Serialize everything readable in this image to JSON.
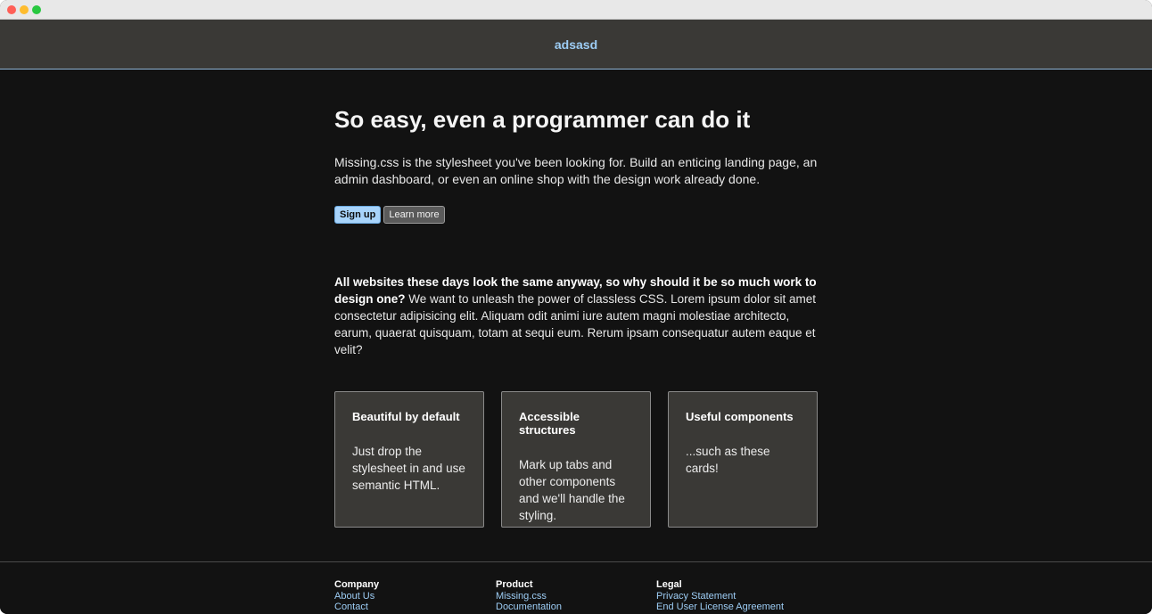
{
  "header": {
    "brand": "adsasd"
  },
  "hero": {
    "title": "So easy, even a programmer can do it",
    "lead": "Missing.css is the stylesheet you've been looking for. Build an enticing landing page, an admin dashboard, or even an online shop with the design work already done.",
    "primary_button": "Sign up",
    "secondary_button": "Learn more"
  },
  "intro": {
    "bold": "All websites these days look the same anyway, so why should it be so much work to design one?",
    "text": " We want to unleash the power of classless CSS. Lorem ipsum dolor sit amet consectetur adipisicing elit. Aliquam odit animi iure autem magni molestiae architecto, earum, quaerat quisquam, totam at sequi eum. Rerum ipsam consequatur autem eaque et velit?"
  },
  "cards": [
    {
      "title": "Beautiful by default",
      "body": "Just drop the stylesheet in and use semantic HTML."
    },
    {
      "title": "Accessible structures",
      "body": "Mark up tabs and other components and we'll handle the styling."
    },
    {
      "title": "Useful components",
      "body": "...such as these cards!"
    }
  ],
  "footer": {
    "columns": [
      {
        "title": "Company",
        "links": [
          "About Us",
          "Contact"
        ]
      },
      {
        "title": "Product",
        "links": [
          "Missing.css",
          "Documentation"
        ]
      },
      {
        "title": "Legal",
        "links": [
          "Privacy Statement",
          "End User License Agreement"
        ]
      }
    ]
  },
  "colors": {
    "accent": "#9dcdf5",
    "background": "#121212",
    "surface": "#3a3936"
  }
}
